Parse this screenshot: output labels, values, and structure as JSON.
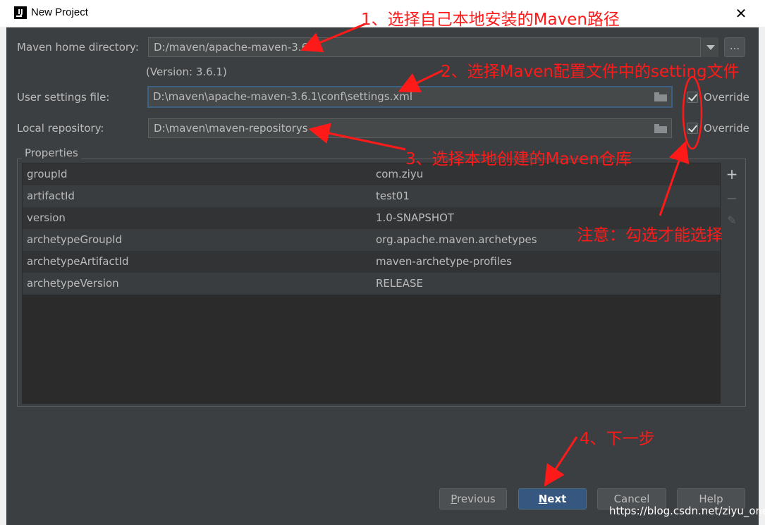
{
  "window": {
    "title": "New Project",
    "app_icon": "intellij-icon",
    "close_glyph": "✕"
  },
  "form": {
    "maven_home_label": "Maven home directory:",
    "maven_home_value": "D:/maven/apache-maven-3.6.1",
    "browse_label": "...",
    "version_text": "(Version: 3.6.1)",
    "user_settings_label": "User settings file:",
    "user_settings_value": "D:\\maven\\apache-maven-3.6.1\\conf\\settings.xml",
    "local_repo_label": "Local repository:",
    "local_repo_value": "D:\\maven\\maven-repositorys",
    "override_label": "Override",
    "override_settings_checked": true,
    "override_repo_checked": true
  },
  "properties": {
    "title": "Properties",
    "rows": [
      {
        "key": "groupId",
        "value": "com.ziyu"
      },
      {
        "key": "artifactId",
        "value": "test01"
      },
      {
        "key": "version",
        "value": "1.0-SNAPSHOT"
      },
      {
        "key": "archetypeGroupId",
        "value": "org.apache.maven.archetypes"
      },
      {
        "key": "archetypeArtifactId",
        "value": "maven-archetype-profiles"
      },
      {
        "key": "archetypeVersion",
        "value": "RELEASE"
      }
    ],
    "tools": {
      "add": "+",
      "remove": "−",
      "edit": "✎"
    }
  },
  "buttons": {
    "previous": {
      "mnemonic": "P",
      "rest": "revious"
    },
    "next": {
      "mnemonic": "N",
      "rest": "ext"
    },
    "cancel": "Cancel",
    "help": "Help"
  },
  "annotations": {
    "a1": "1、选择自己本地安装的Maven路径",
    "a2": "2、选择Maven配置文件中的setting文件",
    "a3": "3、选择本地创建的Maven仓库",
    "note": "注意：勾选才能选择",
    "a4": "4、下一步",
    "color": "#ff1a1a"
  },
  "watermark": "https://blog.csdn.net/ziyu_one"
}
